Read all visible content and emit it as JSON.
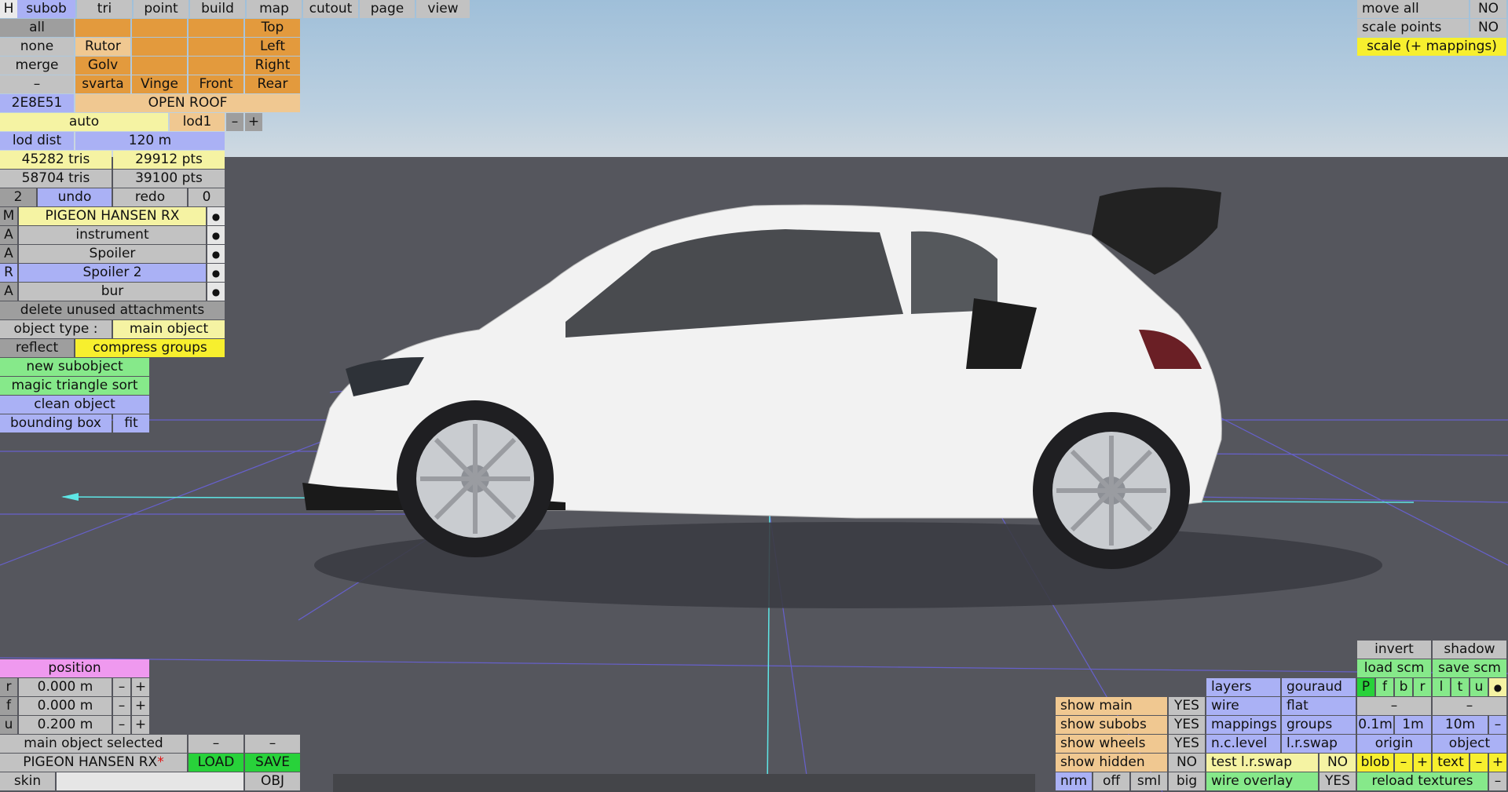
{
  "top_menu": [
    "H",
    "subob",
    "tri",
    "point",
    "build",
    "map",
    "cutout",
    "page",
    "view"
  ],
  "left": {
    "row1": {
      "all": "all",
      "top": "Top"
    },
    "row2": {
      "none": "none",
      "rutor": "Rutor",
      "left": "Left"
    },
    "row3": {
      "merge": "merge",
      "golv": "Golv",
      "right": "Right"
    },
    "row4": {
      "minus": "–",
      "svarta": "svarta",
      "vinge": "Vinge",
      "front": "Front",
      "rear": "Rear"
    },
    "row5": {
      "code": "2E8E51",
      "open_roof": "OPEN ROOF"
    },
    "auto": "auto",
    "lod": "lod1",
    "lod_minus": "–",
    "lod_plus": "+",
    "lod_dist_label": "lod dist",
    "lod_dist_value": "120 m",
    "tris1": "45282 tris",
    "pts1": "29912 pts",
    "tris2": "58704 tris",
    "pts2": "39100 pts",
    "undo_count": "2",
    "undo": "undo",
    "redo": "redo",
    "redo_count": "0",
    "objects": [
      {
        "flag": "M",
        "name": "PIGEON HANSEN RX"
      },
      {
        "flag": "A",
        "name": "instrument"
      },
      {
        "flag": "A",
        "name": "Spoiler"
      },
      {
        "flag": "R",
        "name": "Spoiler 2"
      },
      {
        "flag": "A",
        "name": "bur"
      }
    ],
    "delete_unused": "delete unused attachments",
    "object_type_label": "object type :",
    "object_type_value": "main object",
    "reflect": "reflect",
    "compress_groups": "compress groups",
    "new_subobject": "new subobject",
    "magic_sort": "magic triangle sort",
    "clean_object": "clean object",
    "bounding_box": "bounding box",
    "fit": "fit"
  },
  "top_right": {
    "move_all": "move all",
    "move_all_val": "NO",
    "scale_points": "scale points",
    "scale_points_val": "NO",
    "scale_mappings": "scale (+ mappings)"
  },
  "position": {
    "title": "position",
    "rows": [
      {
        "axis": "r",
        "value": "0.000 m"
      },
      {
        "axis": "f",
        "value": "0.000 m"
      },
      {
        "axis": "u",
        "value": "0.200 m"
      }
    ],
    "minus": "–",
    "plus": "+",
    "main_selected": "main object selected",
    "dash": "–",
    "file_name": "PIGEON HANSEN RX",
    "modified_marker": "*",
    "load": "LOAD",
    "save": "SAVE",
    "skin": "skin",
    "obj": "OBJ"
  },
  "bottom_right": {
    "invert": "invert",
    "shadow": "shadow",
    "load_scm": "load scm",
    "save_scm": "save scm",
    "layers": "layers",
    "gouraud": "gouraud",
    "pfbrltu": [
      "P",
      "f",
      "b",
      "r",
      "l",
      "t",
      "u"
    ],
    "show_main": "show main",
    "show_subobs": "show subobs",
    "show_wheels": "show wheels",
    "show_hidden": "show hidden",
    "yes": "YES",
    "no": "NO",
    "wire": "wire",
    "flat": "flat",
    "mappings": "mappings",
    "groups": "groups",
    "nc_level": "n.c.level",
    "lr_swap": "l.r.swap",
    "test_lr_swap": "test l.r.swap",
    "wire_overlay": "wire overlay",
    "dash": "–",
    "step1": "0.1m",
    "step2": "1m",
    "step3": "10m",
    "origin": "origin",
    "object": "object",
    "blob": "blob",
    "text": "text",
    "minus": "–",
    "plus": "+",
    "nrm": "nrm",
    "off": "off",
    "sml": "sml",
    "big": "big",
    "reload_textures": "reload textures"
  }
}
